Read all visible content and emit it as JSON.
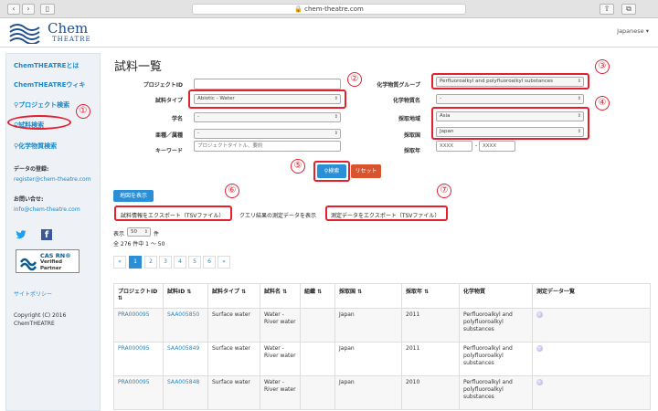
{
  "browser": {
    "url": "chem-theatre.com"
  },
  "header": {
    "logo_title": "Chem",
    "logo_sub": "THEATRE",
    "language": "Japanese ▾"
  },
  "sidebar": {
    "about": "ChemTHEATREとは",
    "wiki": "ChemTHEATREウィキ",
    "project_search": "プロジェクト検索",
    "sample_search": "試料検索",
    "chem_search": "化学物質検索",
    "data_reg_label": "データの登録:",
    "data_reg_email": "register@chem-theatre.com",
    "contact_label": "お問い合せ:",
    "contact_email": "info@chem-theatre.com",
    "cas_title": "CAS RN®",
    "cas_sub1": "Verified",
    "cas_sub2": "Partner",
    "policy": "サイトポリシー",
    "copyright1": "Copyright (C) 2016",
    "copyright2": "ChemTHEATRE"
  },
  "page": {
    "title": "試料一覧"
  },
  "form": {
    "project_id_label": "プロジェクトID",
    "project_id_value": "",
    "sample_type_label": "試料タイプ",
    "sample_type_value": "Abiotic - Water",
    "scientific_name_label": "学名",
    "scientific_name_value": "-",
    "family_label": "亜種／属種",
    "family_value": "-",
    "keyword_label": "キーワード",
    "keyword_placeholder": "プロジェクトタイトル、要約",
    "chem_group_label": "化学物質グループ",
    "chem_group_value": "Perfluoroalkyl and polyfluoroalkyl substances",
    "chem_name_label": "化学物質名",
    "chem_name_value": "-",
    "region_label": "採取地域",
    "region_value": "Asia",
    "country_label": "採取国",
    "country_value": "Japan",
    "year_label": "採取年",
    "year_from": "XXXX",
    "year_sep": "-",
    "year_to": "XXXX",
    "search_button": "検索",
    "reset_button": "リセット"
  },
  "annotations": [
    "①",
    "②",
    "③",
    "④",
    "⑤",
    "⑥",
    "⑦"
  ],
  "actions": {
    "map_button": "地図を表示",
    "export_sample": "試料情報をエクスポート（TSVファイル）",
    "show_query": "クエリ結果の測定データを表示",
    "export_measure": "測定データをエクスポート（TSVファイル）"
  },
  "results": {
    "show_label": "表示",
    "show_count": "50",
    "show_unit": "件",
    "summary": "全 276 件中 1 ～ 50",
    "pages": [
      "«",
      "1",
      "2",
      "3",
      "4",
      "5",
      "6",
      "»"
    ]
  },
  "table": {
    "headers": [
      "プロジェクトID",
      "試料ID",
      "試料タイプ",
      "試料名",
      "組織",
      "採取国",
      "採取年",
      "化学物質",
      "測定データ一覧"
    ],
    "rows": [
      {
        "project": "PRA000095",
        "sample": "SAA005850",
        "type": "Surface water",
        "name1": "Water -",
        "name2": "River water",
        "tissue": "",
        "country": "Japan",
        "year": "2011",
        "chem1": "Perfluoroalkyl and",
        "chem2": "polyfluoroalkyl",
        "chem3": "substances"
      },
      {
        "project": "PRA000095",
        "sample": "SAA005849",
        "type": "Surface water",
        "name1": "Water -",
        "name2": "River water",
        "tissue": "",
        "country": "Japan",
        "year": "2011",
        "chem1": "Perfluoroalkyl and",
        "chem2": "polyfluoroalkyl",
        "chem3": "substances"
      },
      {
        "project": "PRA000095",
        "sample": "SAA005848",
        "type": "Surface water",
        "name1": "Water -",
        "name2": "River water",
        "tissue": "",
        "country": "Japan",
        "year": "2010",
        "chem1": "Perfluoroalkyl and",
        "chem2": "polyfluoroalkyl",
        "chem3": "substances"
      }
    ]
  }
}
